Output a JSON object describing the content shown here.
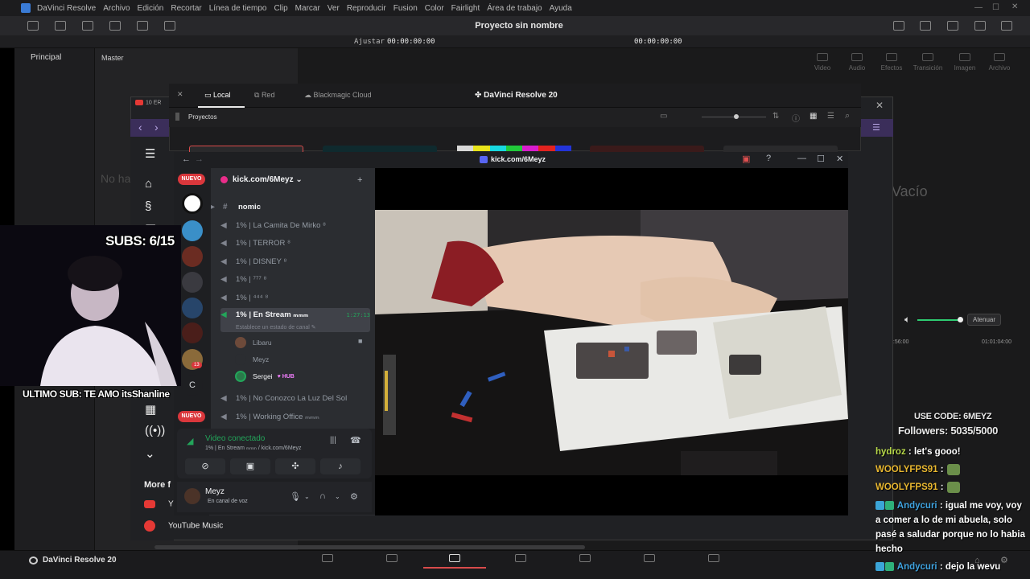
{
  "resolve": {
    "menu": [
      "DaVinci Resolve",
      "Archivo",
      "Edición",
      "Recortar",
      "Línea de tiempo",
      "Clip",
      "Marcar",
      "Ver",
      "Reproducir",
      "Fusion",
      "Color",
      "Fairlight",
      "Área de trabajo",
      "Ayuda"
    ],
    "project_title": "Proyecto sin nombre",
    "timecode_left": "00:00:00:00",
    "timecode_right": "00:00:00:00",
    "zoom_label": "Ajustar",
    "left_panel_header": "Principal",
    "mid_panel_header": "Master",
    "empty_left": "No ha",
    "empty_right": "Vacío",
    "media_tools": [
      "Video",
      "Audio",
      "Efectos",
      "Transición",
      "Imagen",
      "Archivo"
    ],
    "attenuate_label": "Atenuar",
    "ruler_left": "0:56:00",
    "ruler_right": "01:01:04:00",
    "brand_label": "DaVinci Resolve 20"
  },
  "project_manager": {
    "tabs": [
      "Local",
      "Red",
      "Blackmagic Cloud"
    ],
    "active_tab": "Local",
    "title": "DaVinci Resolve 20",
    "section_label": "Proyectos",
    "colorbar": [
      "#d8d8d8",
      "#e8e41b",
      "#18d8e0",
      "#21c93a",
      "#d81ccd",
      "#e2231f",
      "#2334d9"
    ]
  },
  "browser": {
    "tab_label": "10 ER",
    "more_label": "More f",
    "yt_label": "Y",
    "ytmusic_label": "YouTube Music"
  },
  "discord": {
    "window_title": "kick.com/6Meyz",
    "server_name": "kick.com/6Meyz",
    "new_badge": "NUEVO",
    "server_letter": "C",
    "server_badge": "13",
    "category": "nomic",
    "channels": [
      {
        "name": "1% | La Camita De Mirko ⁸"
      },
      {
        "name": "1% | TERROR ⁸"
      },
      {
        "name": "1% | DISNEY ⁸"
      },
      {
        "name": "1% | ⁷⁷⁷ ⁸"
      },
      {
        "name": "1% | ⁴⁴⁴ ⁸"
      }
    ],
    "active_channel": {
      "name": "1% | En Stream ₘₘₘ",
      "time": "1:27:13",
      "status": "Establece un estado de canal"
    },
    "voice_users": [
      {
        "name": "Libaru"
      },
      {
        "name": "Meyz"
      },
      {
        "name": "Sergei",
        "badge": "HUB"
      }
    ],
    "channels_after": [
      {
        "name": "1% | No Conozco La Luz Del Sol"
      },
      {
        "name": "1% | Working Office ₘₘₘ"
      }
    ],
    "voice_connected": "Video conectado",
    "voice_connected_sub": "1% | En Stream ₘₘₘ / kick.com/6Meyz",
    "user_name": "Meyz",
    "user_status": "En canal de voz"
  },
  "overlay": {
    "subs": "SUBS: 6/15",
    "last_sub": "ULTIMO SUB: TE AMO itsShanline",
    "use_code": "USE CODE: 6MEYZ",
    "followers": "Followers: 5035/5000"
  },
  "chat": [
    {
      "user": "hydroz",
      "color": "#b8d94a",
      "text": "let's gooo!"
    },
    {
      "user": "WOOLYFPS91",
      "color": "#e8b730",
      "text": "",
      "emote": true
    },
    {
      "user": "WOOLYFPS91",
      "color": "#e8b730",
      "text": "",
      "emote": true
    },
    {
      "user": "Andycuri",
      "color": "#3fa3e0",
      "text": "igual me voy, voy a comer a lo de mi abuela, solo pasé a saludar porque no lo habia hecho",
      "badge": true
    },
    {
      "user": "Andycuri",
      "color": "#3fa3e0",
      "text": "dejo la wevu",
      "badge": true
    }
  ]
}
